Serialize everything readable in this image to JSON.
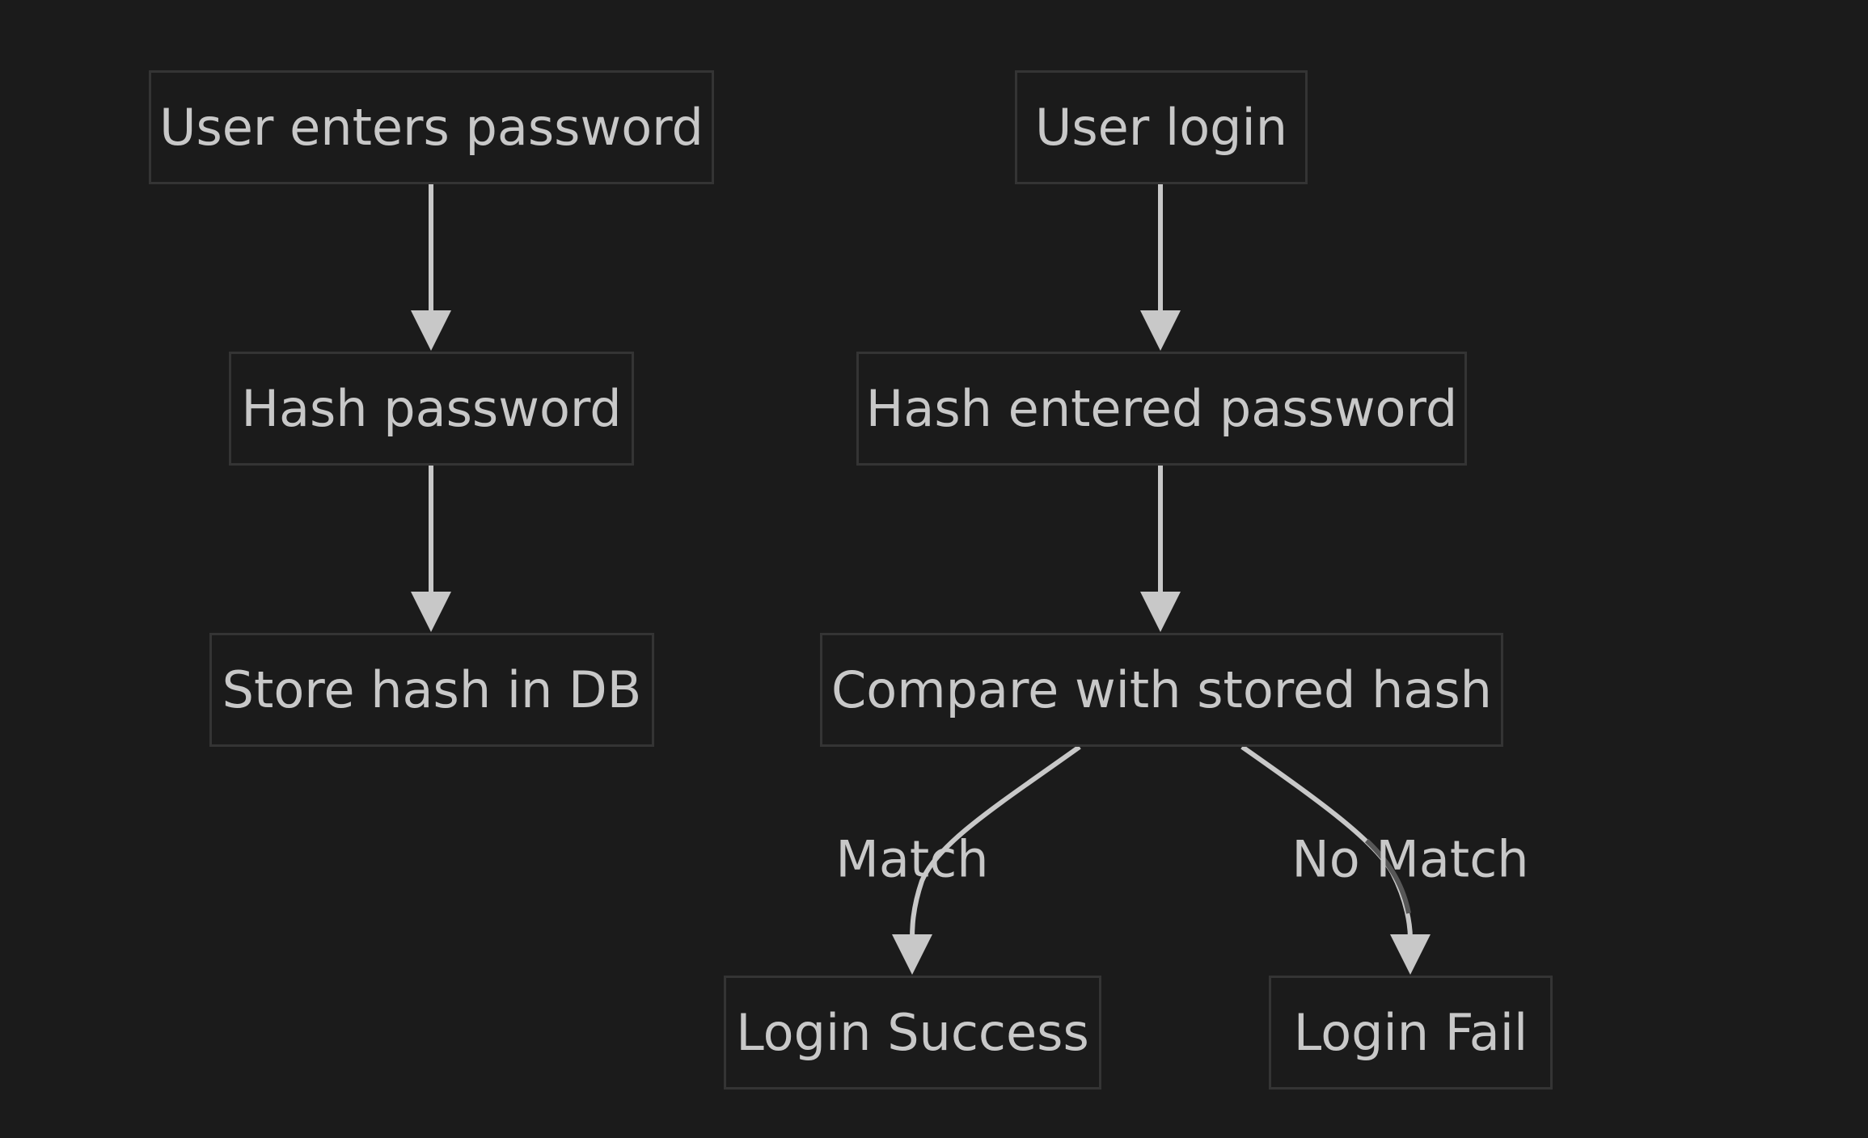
{
  "nodes": {
    "user_enters_password": "User enters password",
    "hash_password": "Hash password",
    "store_hash": "Store hash in DB",
    "user_login": "User login",
    "hash_entered_password": "Hash entered password",
    "compare": "Compare with stored hash",
    "login_success": "Login Success",
    "login_fail": "Login Fail"
  },
  "edge_labels": {
    "match": "Match",
    "no_match": "No Match"
  },
  "colors": {
    "background": "#1b1b1b",
    "text": "#c8c8c8",
    "node_border": "#343434",
    "edge": "#c8c8c8"
  }
}
